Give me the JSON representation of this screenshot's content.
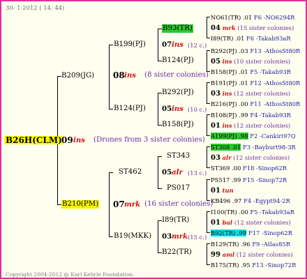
{
  "header_date": "30-  1-2012 ( 14: 44)",
  "footer": "Copyright 2004-2012 @ Karl Kehrle Foundation.",
  "root": {
    "name": "B26H(CLM)",
    "year": "09",
    "breed": "ins",
    "note": "(Drones from 3 sister colonies)"
  },
  "gen1": [
    {
      "name": "B209(JG)",
      "year": "08",
      "breed": "ins",
      "note": "(8 sister colonies)"
    },
    {
      "name": "B210(PM)",
      "year": "07",
      "breed": "mrk",
      "note": "(16 sister colonies)"
    }
  ],
  "gen2": [
    {
      "name": "B199(PJ)",
      "year": "07",
      "breed": "ins",
      "note": "(12 c.)"
    },
    {
      "name": "B124(PJ)",
      "year": "05",
      "breed": "ins",
      "note": "(10 c.)"
    },
    {
      "name": "ST462",
      "year": "05",
      "breed": "alr",
      "note": "(13 c.)"
    },
    {
      "name": "B19(MKK)",
      "year": "03",
      "breed": "mrk",
      "note": "(15 c.)"
    }
  ],
  "gen3": [
    {
      "name": "B93(TR)"
    },
    {
      "name": "B124(PJ)"
    },
    {
      "name": "B292(PJ)"
    },
    {
      "name": "B158(PJ)"
    },
    {
      "name": "ST343"
    },
    {
      "name": "PS017"
    },
    {
      "name": "I89(TR)"
    },
    {
      "name": "B22(TR)"
    }
  ],
  "gen3_info": [
    {
      "year": "07",
      "breed": "ins",
      "note": "(12 c.)"
    },
    {
      "year": "05",
      "breed": "ins",
      "note": "(10 c.)"
    },
    {
      "year": "05",
      "breed": "alr",
      "note": "(13 c.)"
    },
    {
      "year": "03",
      "breed": "mrk",
      "note": "(15 c.)"
    }
  ],
  "gen4_rows": [
    {
      "text": "NO61(TR) .01",
      "info": "F6 -NO6294R"
    },
    {
      "text": "04",
      "breed": "mrk",
      "note": "(15 sister colonies)"
    },
    {
      "text": "I89(TR) .01",
      "info": "F6 -Takab93aR"
    },
    {
      "text": "B292(PJ) .03",
      "info": "F13 -AthosSt80R"
    },
    {
      "text": "05",
      "breed": "ins",
      "note": "(10 sister colonies)"
    },
    {
      "text": "B158(PJ) .01",
      "info": "F5 -Takab93R"
    },
    {
      "text": "B191(PJ) .01",
      "info": "F12 -AthosSt80R"
    },
    {
      "text": "03",
      "breed": "ins",
      "note": "(12 sister colonies)"
    },
    {
      "text": "B216(PJ) .00",
      "info": "F11 -AthosSt80R"
    },
    {
      "text": "B108(PJ) .99",
      "info": "F4 -Takab93R"
    },
    {
      "text": "01",
      "breed": "ins",
      "note": "(12 sister colonies)"
    },
    {
      "text": "A199(PJ) .98",
      "info": "F2 -Cankiri97Q"
    },
    {
      "text": "ST308 .01",
      "info": "F3 -Bayburt98-3R"
    },
    {
      "text": "03",
      "breed": "alr",
      "note": "(12 sister colonies)"
    },
    {
      "text": "ST369 .00",
      "info": "F18 -Sinop62R"
    },
    {
      "text": "PS517 .99",
      "info": "F15 -Sinop72R"
    },
    {
      "text": "01",
      "breed": "tun",
      "note": ""
    },
    {
      "text": "KB496 .97",
      "info": "F4 -Egypt94-2R"
    },
    {
      "text": "I100(TR) .00",
      "info": "F5 -Takab93aR"
    },
    {
      "text": "01",
      "breed": "bal",
      "note": "(12 sister colonies)"
    },
    {
      "text": "B92(TR) .99",
      "info": "F17 -Sinop62R"
    },
    {
      "text": "B129(TR) .96",
      "info": "F9 -Atlas85R"
    },
    {
      "text": "99",
      "breed": "aml",
      "note": "(12 sister colonies)"
    },
    {
      "text": "B175(TR) .95",
      "info": "F13 -Sinop72R"
    }
  ],
  "colors": {
    "border": "#e0309a",
    "background": "#fffff0",
    "highlight_yellow": "#ffff00",
    "highlight_green": "#2ec82e",
    "highlight_cyan": "#00e0e8",
    "info_blue": "#1a1aa0",
    "note_purple": "#6a2aa0",
    "breed_red": "#d01010"
  }
}
